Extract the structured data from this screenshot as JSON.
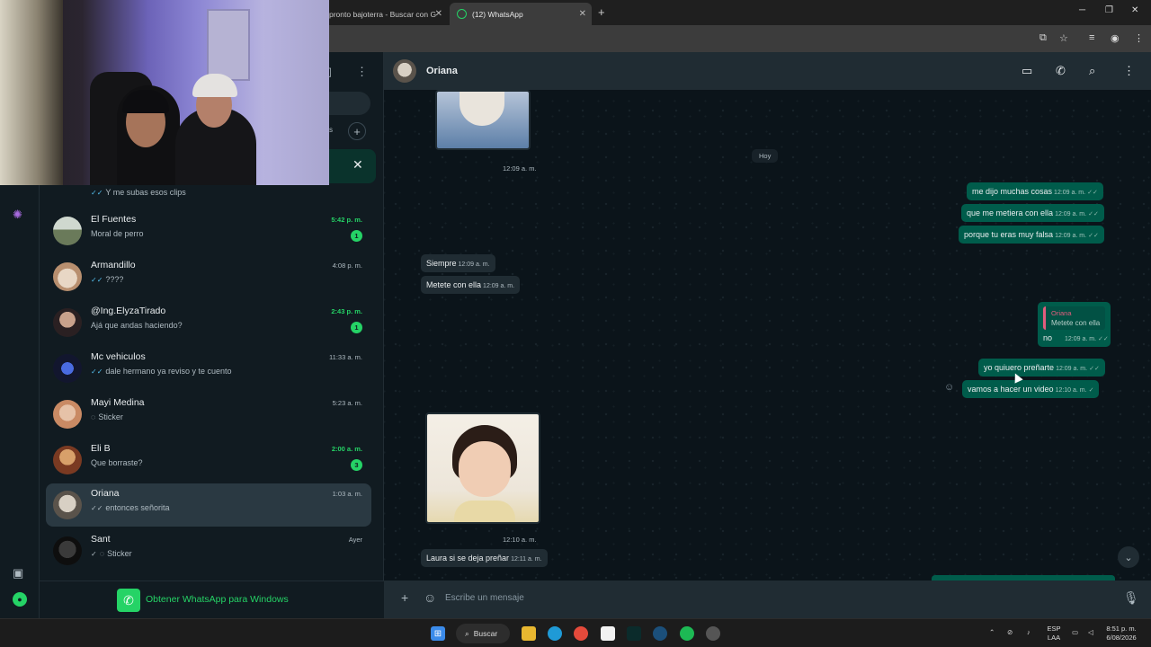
{
  "browser": {
    "tabs": [
      {
        "label": "pronto bajoterra - Buscar con G"
      },
      {
        "label": "(12) WhatsApp"
      }
    ],
    "new_tab": "+"
  },
  "sidebar": {
    "partial_chat": {
      "message": "Y me subas esos clips"
    },
    "chats": [
      {
        "name": "El Fuentes",
        "message": "Moral de perro",
        "time": "5:42 p. m.",
        "badge": "1",
        "unread": true
      },
      {
        "name": "Armandillo",
        "message": "????",
        "time": "4:08 p. m.",
        "read": true
      },
      {
        "name": "@Ing.ElyzaTirado",
        "message": "Ajá que andas haciendo?",
        "time": "2:43 p. m.",
        "badge": "1",
        "unread": true
      },
      {
        "name": "Mc vehiculos",
        "message": "dale hermano ya reviso y te cuento",
        "time": "11:33 a. m.",
        "read": true
      },
      {
        "name": "Mayi Medina",
        "message": "Sticker",
        "time": "5:23 a. m."
      },
      {
        "name": "Eli B",
        "message": "Que borraste?",
        "time": "2:00 a. m.",
        "badge": "3",
        "unread": true
      },
      {
        "name": "Oriana",
        "message": "entonces señorita",
        "time": "1:03 a. m.",
        "selected": true
      },
      {
        "name": "Sant",
        "message": "Sticker",
        "time": "Ayer"
      }
    ],
    "get_whatsapp": "Obtener WhatsApp para Windows"
  },
  "chat": {
    "contact": "Oriana",
    "day_label": "Hoy",
    "messages": {
      "img1_time": "12:09 a. m.",
      "out1": {
        "text": "me dijo muchas cosas",
        "time": "12:09 a. m."
      },
      "out2": {
        "text": "que me metiera con ella",
        "time": "12:09 a. m."
      },
      "out3": {
        "text": "porque tu eras muy falsa",
        "time": "12:09 a. m."
      },
      "in1": {
        "text": "Siempre",
        "time": "12:09 a. m."
      },
      "in2": {
        "text": "Metete con ella",
        "time": "12:09 a. m."
      },
      "reply": {
        "quote_name": "Oriana",
        "quote_text": "Metete con ella",
        "text": "no",
        "time": "12:09 a. m."
      },
      "out4": {
        "text": "yo quiuero preñarte",
        "time": "12:09 a. m."
      },
      "out5": {
        "text": "vamos a hacer un video",
        "time": "12:10 a. m."
      },
      "img2_time": "12:10 a. m.",
      "in3": {
        "text": "Laura si se deja preñar",
        "time": "12:11 a. m."
      }
    },
    "composer_placeholder": "Escribe un mensaje"
  },
  "taskbar": {
    "search_label": "Buscar",
    "lang_top": "ESP",
    "lang_bottom": "LAA",
    "clock_time": "8:51 p. m.",
    "clock_date": "6/08/2026"
  },
  "colors": {
    "accent": "#25d366",
    "outgoing_bubble": "#005c4b",
    "incoming_bubble": "#202c33",
    "panel": "#111b21"
  }
}
